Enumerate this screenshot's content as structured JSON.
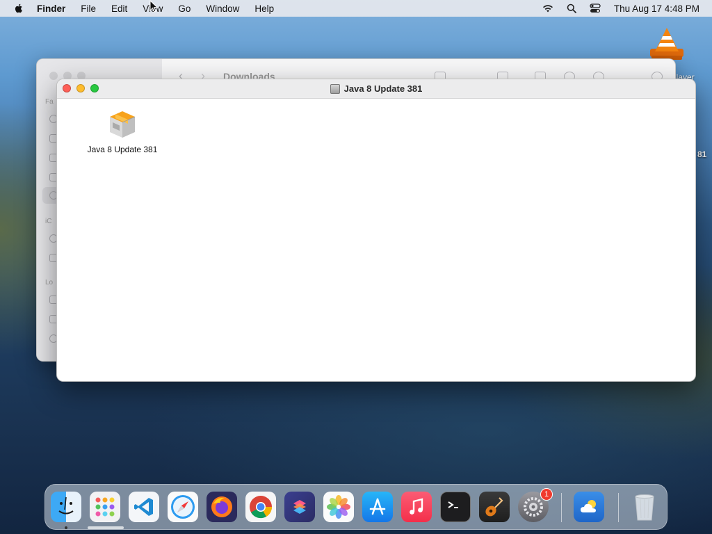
{
  "menubar": {
    "app_name": "Finder",
    "items": [
      "File",
      "Edit",
      "View",
      "Go",
      "Window",
      "Help"
    ],
    "clock": "Thu Aug 17  4:48 PM"
  },
  "desktop": {
    "vlc_label": "player",
    "partial_text": "81"
  },
  "background_window": {
    "title": "Downloads",
    "sidebar_headers": [
      "Fa",
      "iC",
      "Lo"
    ]
  },
  "dmg_window": {
    "title": "Java 8 Update 381",
    "item": {
      "label": "Java 8 Update 381"
    }
  },
  "dock": {
    "items": [
      {
        "name": "Finder",
        "icon": "finder-icon"
      },
      {
        "name": "Launchpad",
        "icon": "launchpad-icon"
      },
      {
        "name": "Visual Studio Code",
        "icon": "vscode-icon"
      },
      {
        "name": "Safari",
        "icon": "safari-icon"
      },
      {
        "name": "Firefox",
        "icon": "firefox-icon"
      },
      {
        "name": "Chrome",
        "icon": "chrome-icon"
      },
      {
        "name": "Shortcuts",
        "icon": "shortcuts-icon"
      },
      {
        "name": "Photos",
        "icon": "photos-icon"
      },
      {
        "name": "App Store",
        "icon": "app-store-icon"
      },
      {
        "name": "Music",
        "icon": "music-icon"
      },
      {
        "name": "Terminal",
        "icon": "terminal-icon"
      },
      {
        "name": "GarageBand",
        "icon": "garageband-icon"
      },
      {
        "name": "System Preferences",
        "icon": "system-preferences-icon"
      },
      {
        "name": "Weather",
        "icon": "weather-icon"
      },
      {
        "name": "Trash",
        "icon": "trash-icon"
      }
    ],
    "system_preferences_badge": "1"
  },
  "colors": {
    "close": "#fe5f57",
    "minimize": "#febc2e",
    "maximize": "#28c840",
    "badge": "#f03a2e"
  }
}
